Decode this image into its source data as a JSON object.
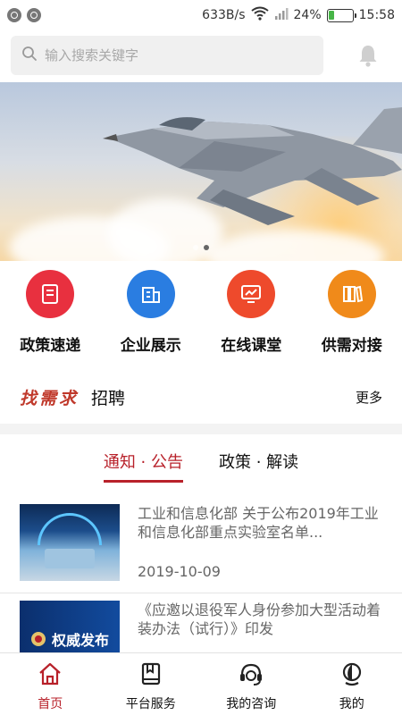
{
  "status_bar": {
    "speed": "633B/s",
    "battery_percent": "24%",
    "battery_level": 0.24,
    "time": "15:58"
  },
  "search": {
    "placeholder": "输入搜索关键字"
  },
  "banner": {
    "slide_count": 2,
    "active_index": 1
  },
  "quick_menu": [
    {
      "label": "政策速递",
      "icon": "document-icon",
      "color": "#e8303f"
    },
    {
      "label": "企业展示",
      "icon": "building-icon",
      "color": "#2a7de1"
    },
    {
      "label": "在线课堂",
      "icon": "monitor-chart-icon",
      "color": "#ee4a2c"
    },
    {
      "label": "供需对接",
      "icon": "books-icon",
      "color": "#f08a1a"
    }
  ],
  "demand": {
    "brand": "找需求",
    "text": "招聘",
    "more": "更多"
  },
  "tabs": [
    {
      "label": "通知 · 公告",
      "active": true
    },
    {
      "label": "政策 · 解读",
      "active": false
    }
  ],
  "news": [
    {
      "title": "工业和信息化部 关于公布2019年工业和信息化部重点实验室名单...",
      "date": "2019-10-09",
      "thumb": "lab-photo"
    },
    {
      "title": "《应邀以退役军人身份参加大型活动着装办法（试行）》印发",
      "date": "",
      "thumb": "权威发布"
    }
  ],
  "tabbar": [
    {
      "label": "首页",
      "icon": "home-icon",
      "active": true
    },
    {
      "label": "平台服务",
      "icon": "bookmark-book-icon",
      "active": false
    },
    {
      "label": "我的咨询",
      "icon": "headset-icon",
      "active": false
    },
    {
      "label": "我的",
      "icon": "user-icon",
      "active": false
    }
  ],
  "colors": {
    "accent": "#b8212a"
  }
}
